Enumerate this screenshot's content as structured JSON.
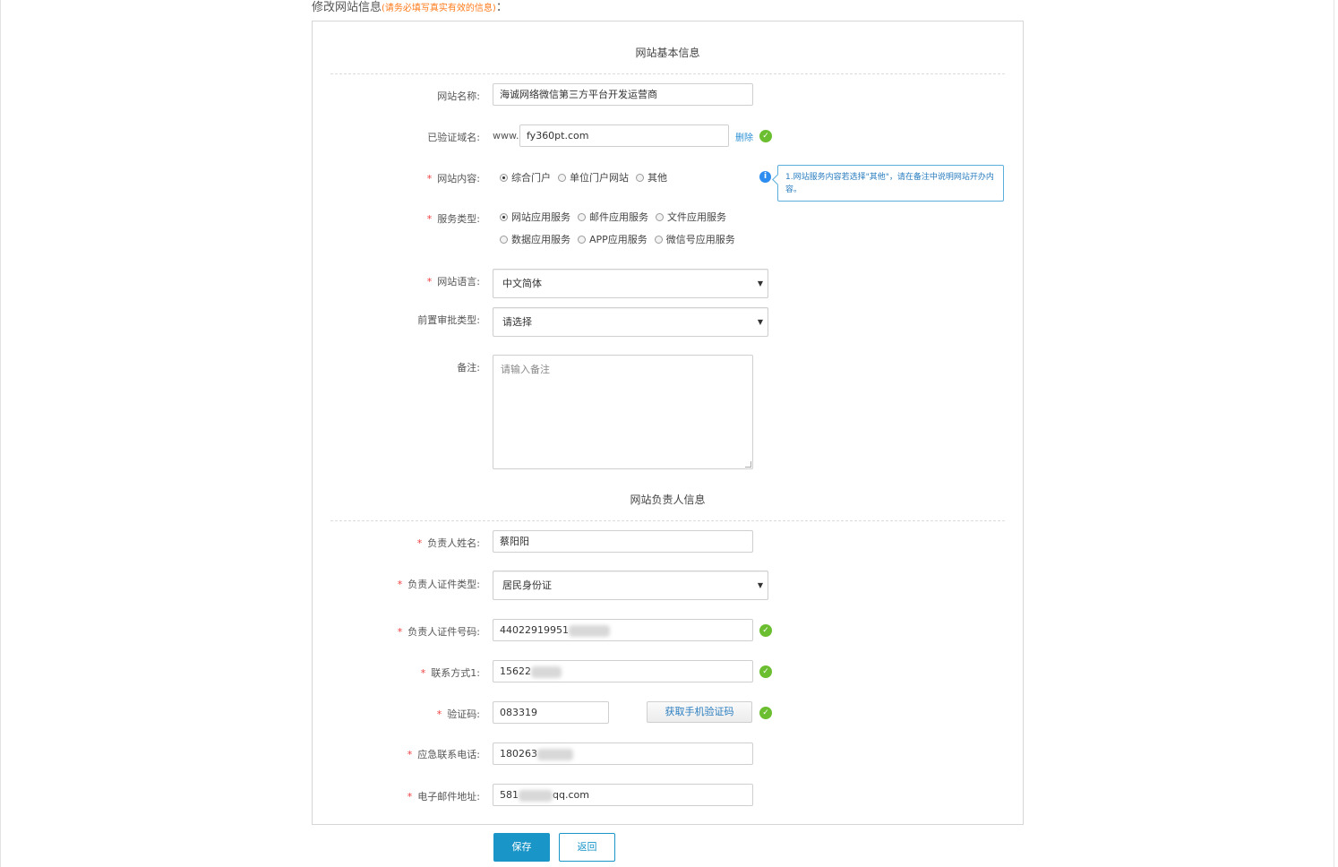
{
  "page": {
    "title": "修改网站信息",
    "title_note": "(请务必填写真实有效的信息)",
    "title_suffix": "："
  },
  "basic": {
    "section_title": "网站基本信息",
    "site_name": {
      "label": "网站名称:",
      "value": "海诚网络微信第三方平台开发运营商"
    },
    "domain": {
      "label": "已验证域名:",
      "prefix": "www.",
      "value": "fy360pt.com",
      "delete_label": "删除"
    },
    "content": {
      "label": "网站内容:",
      "options": [
        "综合门户",
        "单位门户网站",
        "其他"
      ],
      "selected": "综合门户",
      "hint": "1.网站服务内容若选择\"其他\"，请在备注中说明网站开办内容。"
    },
    "service_type": {
      "label": "服务类型:",
      "options_row1": [
        "网站应用服务",
        "邮件应用服务",
        "文件应用服务"
      ],
      "options_row2": [
        "数据应用服务",
        "APP应用服务",
        "微信号应用服务"
      ],
      "selected": "网站应用服务"
    },
    "language": {
      "label": "网站语言:",
      "value": "中文简体"
    },
    "approval": {
      "label": "前置审批类型:",
      "value": "请选择"
    },
    "remark": {
      "label": "备注:",
      "placeholder": "请输入备注"
    }
  },
  "owner": {
    "section_title": "网站负责人信息",
    "name": {
      "label": "负责人姓名:",
      "value": "蔡阳阳"
    },
    "id_type": {
      "label": "负责人证件类型:",
      "value": "居民身份证"
    },
    "id_number": {
      "label": "负责人证件号码:",
      "value": "44022919951"
    },
    "phone": {
      "label": "联系方式1:",
      "value": "15622"
    },
    "code": {
      "label": "验证码:",
      "value": "083319",
      "button_label": "获取手机验证码"
    },
    "emergency": {
      "label": "应急联系电话:",
      "value": "180263"
    },
    "email": {
      "label": "电子邮件地址:",
      "value_prefix": "581",
      "value_suffix": "qq.com"
    }
  },
  "actions": {
    "save_label": "保存",
    "back_label": "返回"
  },
  "colors": {
    "primary": "#1a95c8",
    "success": "#6abe2f",
    "required": "#f04040",
    "warning_note": "#ff7a1a",
    "hint": "#2a7dc0"
  },
  "icons": {
    "valid": "check-circle-icon",
    "info": "info-icon",
    "select_caret": "caret-down-icon"
  }
}
